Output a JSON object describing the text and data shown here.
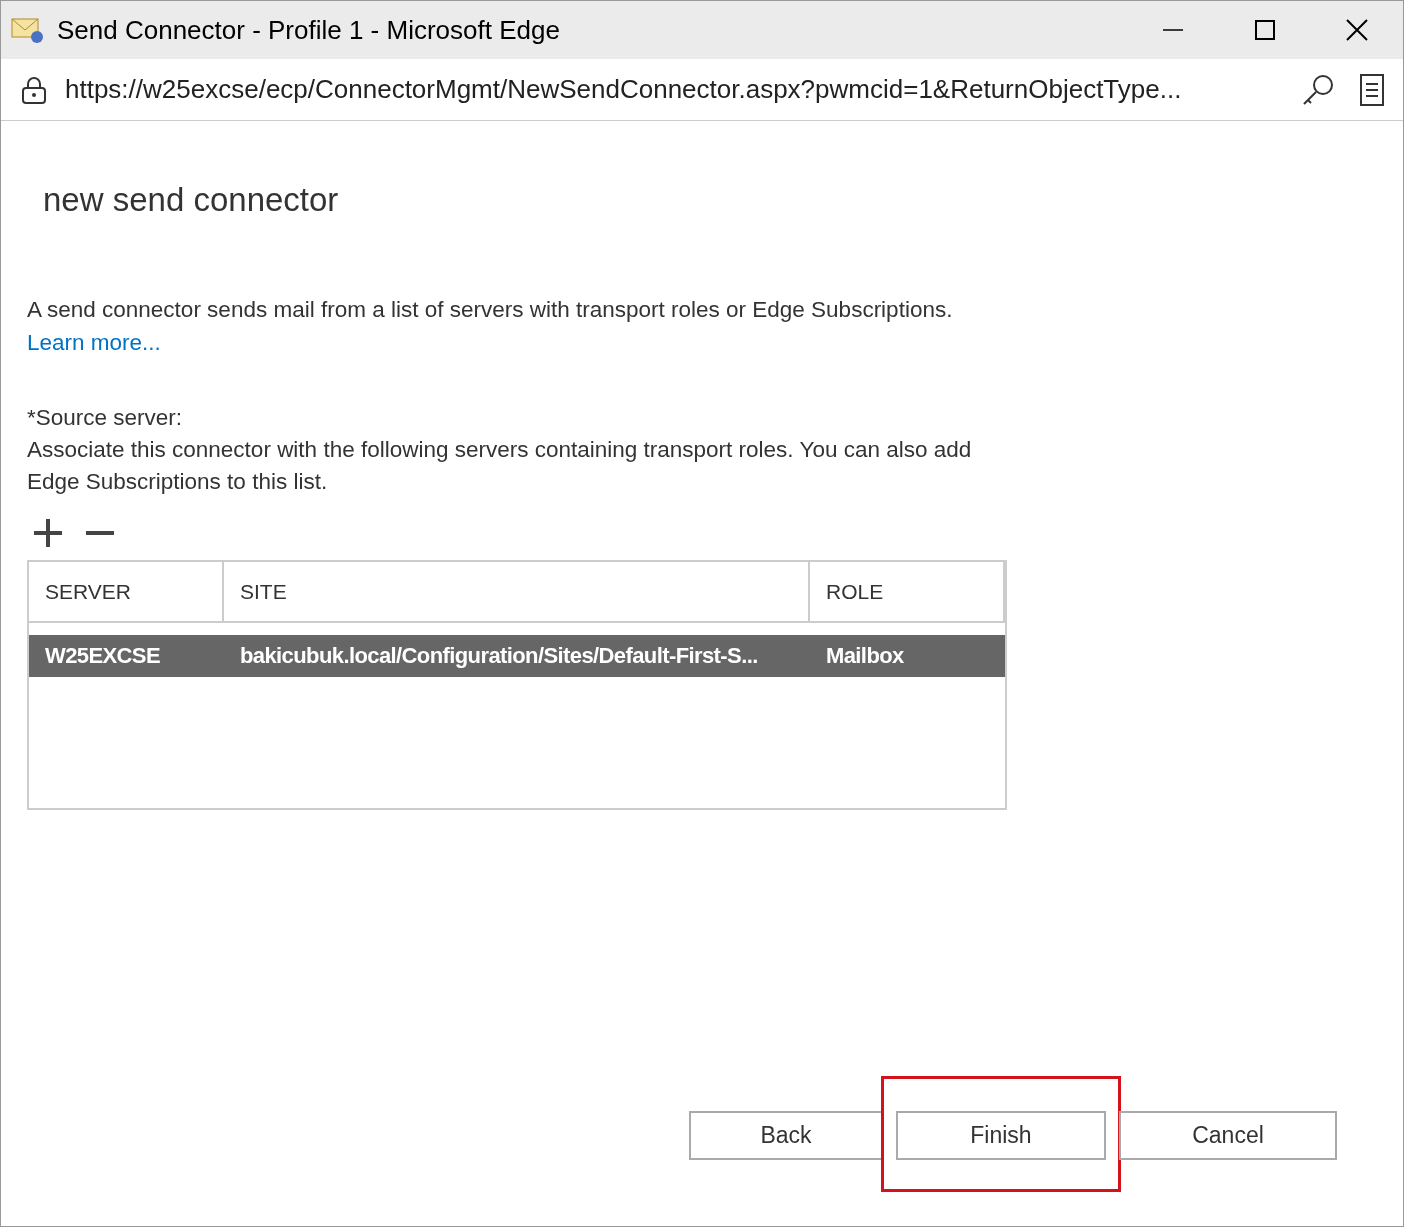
{
  "window": {
    "title": "Send Connector - Profile 1 - Microsoft Edge"
  },
  "address_bar": {
    "url": "https://w25excse/ecp/ConnectorMgmt/NewSendConnector.aspx?pwmcid=1&ReturnObjectType..."
  },
  "page": {
    "heading": "new send connector",
    "description": "A send connector sends mail from a list of servers with transport roles or Edge Subscriptions.",
    "learn_more": "Learn more...",
    "source_label": "*Source server:",
    "source_help": "Associate this connector with the following servers containing transport roles. You can also add Edge Subscriptions to this list."
  },
  "toolbar": [
    {
      "kind": "add"
    },
    {
      "kind": "remove"
    }
  ],
  "table": {
    "columns": [
      "SERVER",
      "SITE",
      "ROLE"
    ],
    "rows": [
      {
        "cells": [
          "W25EXCSE",
          "bakicubuk.local/Configuration/Sites/Default-First-S...",
          "Mailbox"
        ],
        "selected": true
      }
    ]
  },
  "buttons": [
    {
      "label": "Back",
      "highlighted": false
    },
    {
      "label": "Finish",
      "highlighted": true
    },
    {
      "label": "Cancel",
      "highlighted": false
    }
  ]
}
